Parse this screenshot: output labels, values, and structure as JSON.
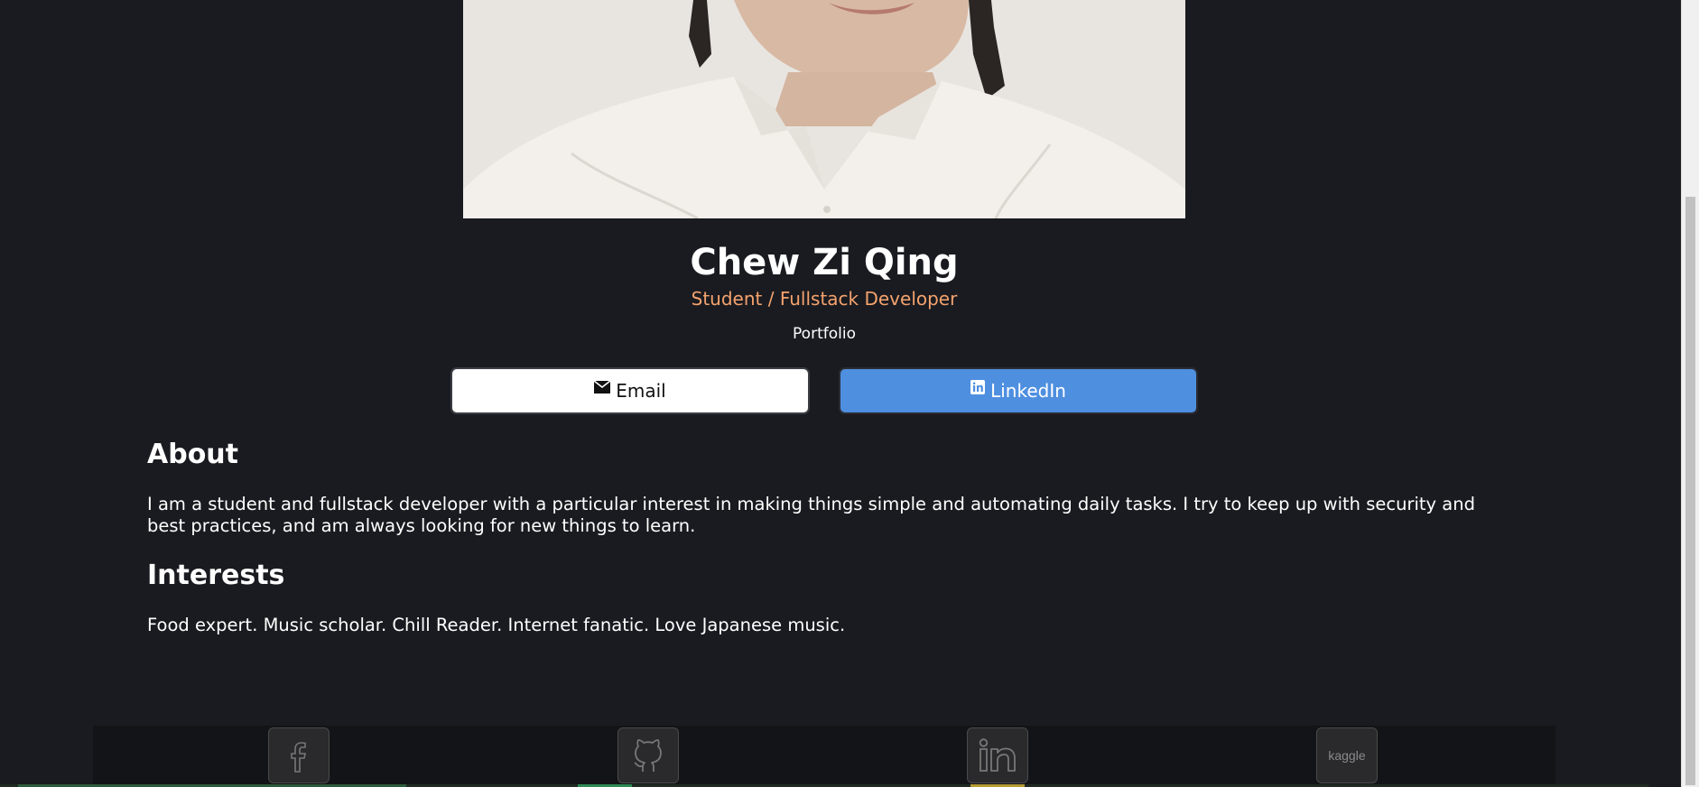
{
  "profile": {
    "name": "Chew Zi Qing",
    "role": "Student / Fullstack Developer",
    "portfolio_label": "Portfolio"
  },
  "buttons": {
    "email_label": "Email",
    "linkedin_label": "LinkedIn"
  },
  "about": {
    "title": "About",
    "text": "I am a student and fullstack developer with a particular interest in making things simple and automating daily tasks. I try to keep up with security and best practices, and am always looking for new things to learn."
  },
  "interests": {
    "title": "Interests",
    "text": "Food expert. Music scholar. Chill Reader. Internet fanatic. Love Japanese music."
  },
  "footer": {
    "socials": [
      {
        "name": "facebook",
        "icon": "facebook-icon"
      },
      {
        "name": "github",
        "icon": "github-icon"
      },
      {
        "name": "linkedin",
        "icon": "linkedin-icon"
      },
      {
        "name": "kaggle",
        "icon": "kaggle-icon",
        "label": "kaggle"
      }
    ]
  },
  "colors": {
    "background": "#1a1b20",
    "accent_orange": "#f4a36e",
    "linkedin_blue": "#4f8fe0"
  }
}
